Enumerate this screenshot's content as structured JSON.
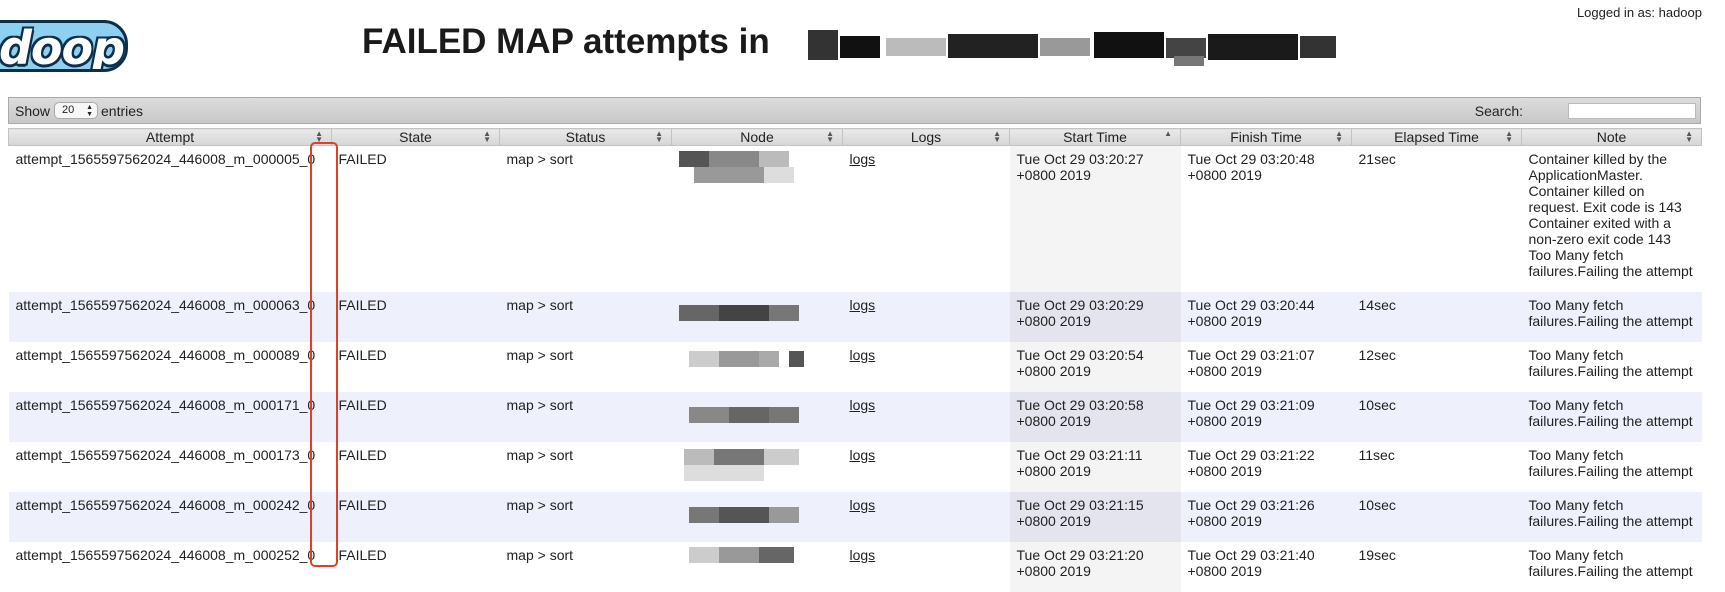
{
  "header": {
    "logo_text": "doop",
    "logged_in": "Logged in as: hadoop",
    "title": "FAILED MAP attempts in "
  },
  "toolbar": {
    "show_label": "Show",
    "entries_value": "20",
    "entries_label": "entries",
    "search_label": "Search:",
    "search_value": ""
  },
  "columns": [
    {
      "label": "Attempt"
    },
    {
      "label": "State"
    },
    {
      "label": "Status"
    },
    {
      "label": "Node"
    },
    {
      "label": "Logs"
    },
    {
      "label": "Start Time"
    },
    {
      "label": "Finish Time"
    },
    {
      "label": "Elapsed Time"
    },
    {
      "label": "Note"
    }
  ],
  "rows": [
    {
      "attempt": "attempt_1565597562024_446008_m_000005_0",
      "state": "FAILED",
      "status": "map > sort",
      "logs": "logs",
      "start": "Tue Oct 29 03:20:27 +0800 2019",
      "finish": "Tue Oct 29 03:20:48 +0800 2019",
      "elapsed": "21sec",
      "note": "Container killed by the ApplicationMaster. Container killed on request. Exit code is 143 Container exited with a non-zero exit code 143 Too Many fetch failures.Failing the attempt"
    },
    {
      "attempt": "attempt_1565597562024_446008_m_000063_0",
      "state": "FAILED",
      "status": "map > sort",
      "logs": "logs",
      "start": "Tue Oct 29 03:20:29 +0800 2019",
      "finish": "Tue Oct 29 03:20:44 +0800 2019",
      "elapsed": "14sec",
      "note": "Too Many fetch failures.Failing the attempt"
    },
    {
      "attempt": "attempt_1565597562024_446008_m_000089_0",
      "state": "FAILED",
      "status": "map > sort",
      "logs": "logs",
      "start": "Tue Oct 29 03:20:54 +0800 2019",
      "finish": "Tue Oct 29 03:21:07 +0800 2019",
      "elapsed": "12sec",
      "note": "Too Many fetch failures.Failing the attempt"
    },
    {
      "attempt": "attempt_1565597562024_446008_m_000171_0",
      "state": "FAILED",
      "status": "map > sort",
      "logs": "logs",
      "start": "Tue Oct 29 03:20:58 +0800 2019",
      "finish": "Tue Oct 29 03:21:09 +0800 2019",
      "elapsed": "10sec",
      "note": "Too Many fetch failures.Failing the attempt"
    },
    {
      "attempt": "attempt_1565597562024_446008_m_000173_0",
      "state": "FAILED",
      "status": "map > sort",
      "logs": "logs",
      "start": "Tue Oct 29 03:21:11 +0800 2019",
      "finish": "Tue Oct 29 03:21:22 +0800 2019",
      "elapsed": "11sec",
      "note": "Too Many fetch failures.Failing the attempt"
    },
    {
      "attempt": "attempt_1565597562024_446008_m_000242_0",
      "state": "FAILED",
      "status": "map > sort",
      "logs": "logs",
      "start": "Tue Oct 29 03:21:15 +0800 2019",
      "finish": "Tue Oct 29 03:21:26 +0800 2019",
      "elapsed": "10sec",
      "note": "Too Many fetch failures.Failing the attempt"
    },
    {
      "attempt": "attempt_1565597562024_446008_m_000252_0",
      "state": "FAILED",
      "status": "map > sort",
      "logs": "logs",
      "start": "Tue Oct 29 03:21:20 +0800 2019",
      "finish": "Tue Oct 29 03:21:40 +0800 2019",
      "elapsed": "19sec",
      "note": "Too Many fetch failures.Failing the attempt"
    }
  ],
  "colors": {
    "accent_highlight": "#e0402a",
    "row_alt": "#eef0fb",
    "sorted_col": "#f4f4f4"
  }
}
